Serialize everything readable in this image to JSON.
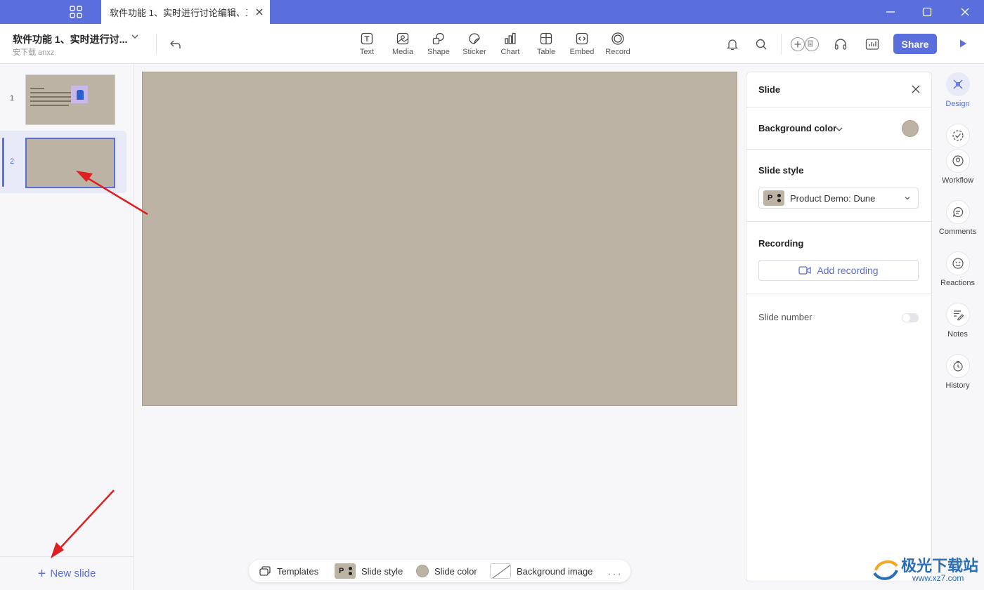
{
  "app": {
    "tab_title": "软件功能 1、实时进行讨论编辑、三",
    "doc_title": "软件功能 1、实时进行讨...",
    "doc_subtitle": "安下载 anxz",
    "accent": "#5a6fdb"
  },
  "toolbar": {
    "tools": [
      {
        "label": "Text",
        "icon": "text-icon"
      },
      {
        "label": "Media",
        "icon": "media-icon"
      },
      {
        "label": "Shape",
        "icon": "shape-icon"
      },
      {
        "label": "Sticker",
        "icon": "sticker-icon"
      },
      {
        "label": "Chart",
        "icon": "chart-icon"
      },
      {
        "label": "Table",
        "icon": "table-icon"
      },
      {
        "label": "Embed",
        "icon": "embed-icon"
      },
      {
        "label": "Record",
        "icon": "record-icon"
      }
    ],
    "share_label": "Share"
  },
  "slides": {
    "items": [
      {
        "number": "1",
        "selected": false
      },
      {
        "number": "2",
        "selected": true
      }
    ],
    "new_slide_label": "New slide",
    "slide_color": "#bcb3a4"
  },
  "bottom_bar": {
    "templates_label": "Templates",
    "slide_style_label": "Slide style",
    "slide_color_label": "Slide color",
    "background_image_label": "Background image",
    "more": "···"
  },
  "panel": {
    "title": "Slide",
    "background_color_label": "Background color",
    "slide_style_label": "Slide style",
    "slide_style_value": "Product Demo: Dune",
    "style_badge": "P",
    "recording_label": "Recording",
    "add_recording_label": "Add recording",
    "slide_number_label": "Slide number",
    "slide_number_on": false
  },
  "rail": {
    "design": "Design",
    "workflow": "Workflow",
    "comments": "Comments",
    "reactions": "Reactions",
    "notes": "Notes",
    "history": "History"
  },
  "watermark": {
    "text": "极光下载站",
    "url": "www.xz7.com"
  }
}
